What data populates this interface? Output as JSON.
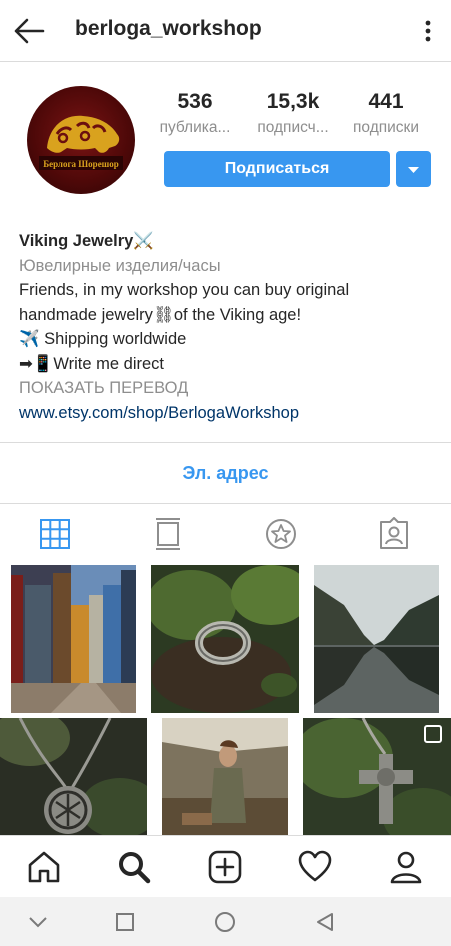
{
  "header": {
    "username": "berloga_workshop",
    "back_icon": "back-arrow-icon",
    "menu_icon": "more-vertical-icon"
  },
  "profile": {
    "avatar_icon": "berloga-workshop-logo",
    "avatar_text": "Берлога Шорешор",
    "stats": [
      {
        "value": "536",
        "label": "публика..."
      },
      {
        "value": "15,3k",
        "label": "подписч..."
      },
      {
        "value": "441",
        "label": "подписки"
      }
    ],
    "follow_label": "Подписаться",
    "dropdown_icon": "caret-down-icon"
  },
  "bio": {
    "name": "Viking Jewelry",
    "name_emoji": "⚔️",
    "category": "Ювелирные изделия/часы",
    "line1": "Friends, in my workshop you can buy original",
    "line2": "handmade jewelry⛓of the Viking age!",
    "line3_emoji": "✈️",
    "line3": " Shipping worldwide",
    "line4_emoji": "➡📱",
    "line4": "Write me direct",
    "translate": "ПОКАЗАТЬ ПЕРЕВОД",
    "link": "www.etsy.com/shop/BerlogaWorkshop"
  },
  "contact": {
    "email_label": "Эл. адрес"
  },
  "tabs": [
    "grid-icon",
    "feed-icon",
    "guides-icon",
    "tagged-icon"
  ],
  "grid": [
    "bergen-street-photo",
    "viking-ring-on-moss-photo",
    "fjord-landscape-photo",
    "celtic-pendant-necklace-photo",
    "viking-reenactor-tent-photo",
    "silver-cross-pendant-photo"
  ],
  "bottom_nav": [
    "home-icon",
    "search-icon",
    "add-post-icon",
    "heart-icon",
    "profile-icon"
  ],
  "system_nav": [
    "chevron-down-icon",
    "square-icon",
    "circle-icon",
    "back-triangle-icon"
  ],
  "colors": {
    "accent": "#3897f0",
    "link": "#003569",
    "muted": "#8e8e8e"
  }
}
